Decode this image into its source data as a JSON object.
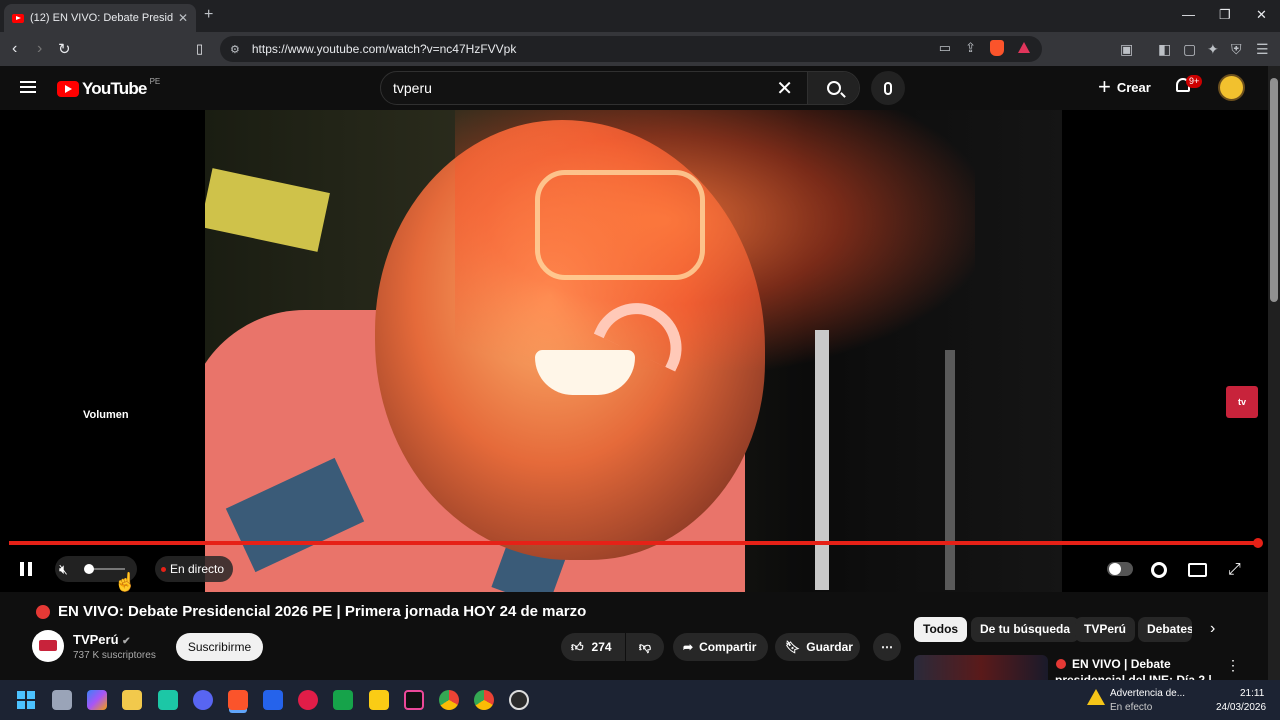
{
  "browser": {
    "tab_title": "(12)  EN VIVO: Debate Presid",
    "url": "https://www.youtube.com/watch?v=nc47HzFVVpk"
  },
  "youtube": {
    "logo_text": "YouTube",
    "country_code": "PE",
    "search_query": "tvperu",
    "create_label": "Crear",
    "notifications_badge": "9+"
  },
  "player": {
    "tooltip": "Volumen",
    "live_label": "En directo",
    "watermark": "tv",
    "progress": 1.0,
    "volume": 0.0,
    "accent": "#e62117"
  },
  "video": {
    "title": "EN VIVO: Debate Presidencial 2026 PE | Primera jornada HOY 24 de marzo",
    "channel_name": "TVPerú",
    "subscribers": "737 K suscriptores",
    "subscribe_label": "Suscribirme",
    "likes": "274",
    "share_label": "Compartir",
    "save_label": "Guardar"
  },
  "sidebar": {
    "chips": [
      "Todos",
      "De tu búsqueda",
      "TVPerú",
      "Debates"
    ],
    "related_title_line1": "EN VIVO | Debate",
    "related_title_line2": "presidencial del  INE: Día 2 |"
  },
  "taskbar": {
    "notice_title": "Advertencia de...",
    "notice_status": "En efecto",
    "time": "21:11",
    "date": "24/03/2026"
  }
}
